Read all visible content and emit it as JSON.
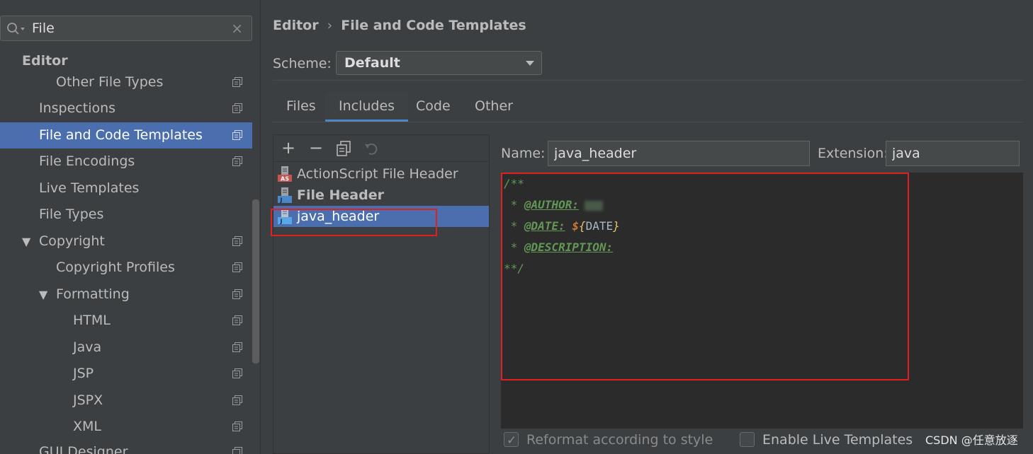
{
  "search": {
    "value": "File"
  },
  "sidebar": {
    "items": [
      {
        "label": "Editor"
      },
      {
        "label": "Other File Types"
      },
      {
        "label": "Inspections"
      },
      {
        "label": "File and Code Templates"
      },
      {
        "label": "File Encodings"
      },
      {
        "label": "Live Templates"
      },
      {
        "label": "File Types"
      },
      {
        "label": "Copyright"
      },
      {
        "label": "Copyright Profiles"
      },
      {
        "label": "Formatting"
      },
      {
        "label": "HTML"
      },
      {
        "label": "Java"
      },
      {
        "label": "JSP"
      },
      {
        "label": "JSPX"
      },
      {
        "label": "XML"
      },
      {
        "label": "GUI Designer"
      }
    ],
    "selected": "File and Code Templates"
  },
  "breadcrumb": {
    "parent": "Editor",
    "current": "File and Code Templates"
  },
  "scheme": {
    "label": "Scheme:",
    "value": "Default"
  },
  "tabs": [
    {
      "label": "Files"
    },
    {
      "label": "Includes"
    },
    {
      "label": "Code"
    },
    {
      "label": "Other"
    }
  ],
  "active_tab": "Includes",
  "templates": {
    "items": [
      {
        "label": "ActionScript File Header",
        "icon_badge": "AS"
      },
      {
        "label": "File Header",
        "icon_badge": "J"
      },
      {
        "label": "java_header",
        "icon_badge": "J"
      }
    ],
    "selected": "java_header"
  },
  "editor": {
    "name_label": "Name:",
    "name_value": "java_header",
    "extension_label": "Extension:",
    "extension_value": "java",
    "code": {
      "line1": "/**",
      "star": " * ",
      "author_tag": "@AUTHOR:",
      "date_tag": "@DATE:",
      "dollar": "$",
      "brace_open": "{",
      "date_var": "DATE",
      "brace_close": "}",
      "description_tag": "@DESCRIPTION:",
      "line5": "**/"
    }
  },
  "options": {
    "reformat_label": "Reformat according to style",
    "live_templates_label": "Enable Live Templates"
  },
  "watermark": "CSDN @任意放逐",
  "colors": {
    "selection": "#4b6eaf",
    "highlight_box": "#e02020",
    "comment": "#629755",
    "tab_underline": "#4a88c7"
  }
}
